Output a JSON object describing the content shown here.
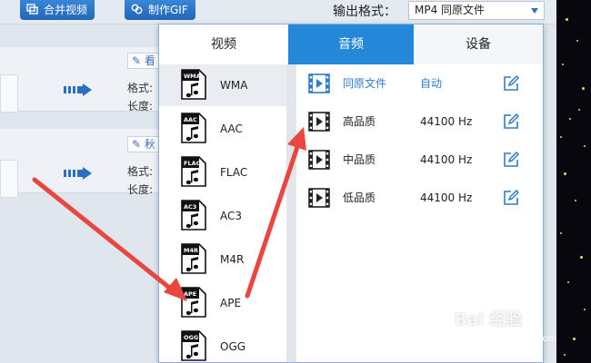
{
  "toolbar": {
    "merge_label": "合并视频",
    "gif_label": "制作GIF",
    "output_format_label": "输出格式：",
    "output_format_value": "MP4  同原文件"
  },
  "background_rows": [
    {
      "edit_label": "看",
      "format_label": "格式:",
      "length_label": "长度:"
    },
    {
      "edit_label": "秋",
      "format_label": "格式:",
      "length_label": "长度:"
    }
  ],
  "popup": {
    "tabs": [
      "视频",
      "音频",
      "设备"
    ],
    "active_tab": "音频",
    "formats": [
      {
        "name": "WMA",
        "badge": "WMA",
        "selected": true
      },
      {
        "name": "AAC",
        "badge": "AAC"
      },
      {
        "name": "FLAC",
        "badge": "FLAC"
      },
      {
        "name": "AC3",
        "badge": "AC3"
      },
      {
        "name": "M4R",
        "badge": "M4R"
      },
      {
        "name": "APE",
        "badge": "APE"
      },
      {
        "name": "OGG",
        "badge": "OGG"
      }
    ],
    "qualities": [
      {
        "name": "同原文件",
        "rate": "自动"
      },
      {
        "name": "高品质",
        "rate": "44100 Hz"
      },
      {
        "name": "中品质",
        "rate": "44100 Hz"
      },
      {
        "name": "低品质",
        "rate": "44100 Hz"
      }
    ]
  },
  "watermark": {
    "text": "Bai 经验",
    "sub": "jingyan.baidu.com"
  },
  "colors": {
    "accent": "#2487d8",
    "annotation": "#e8463e",
    "link": "#2f7cc9"
  }
}
